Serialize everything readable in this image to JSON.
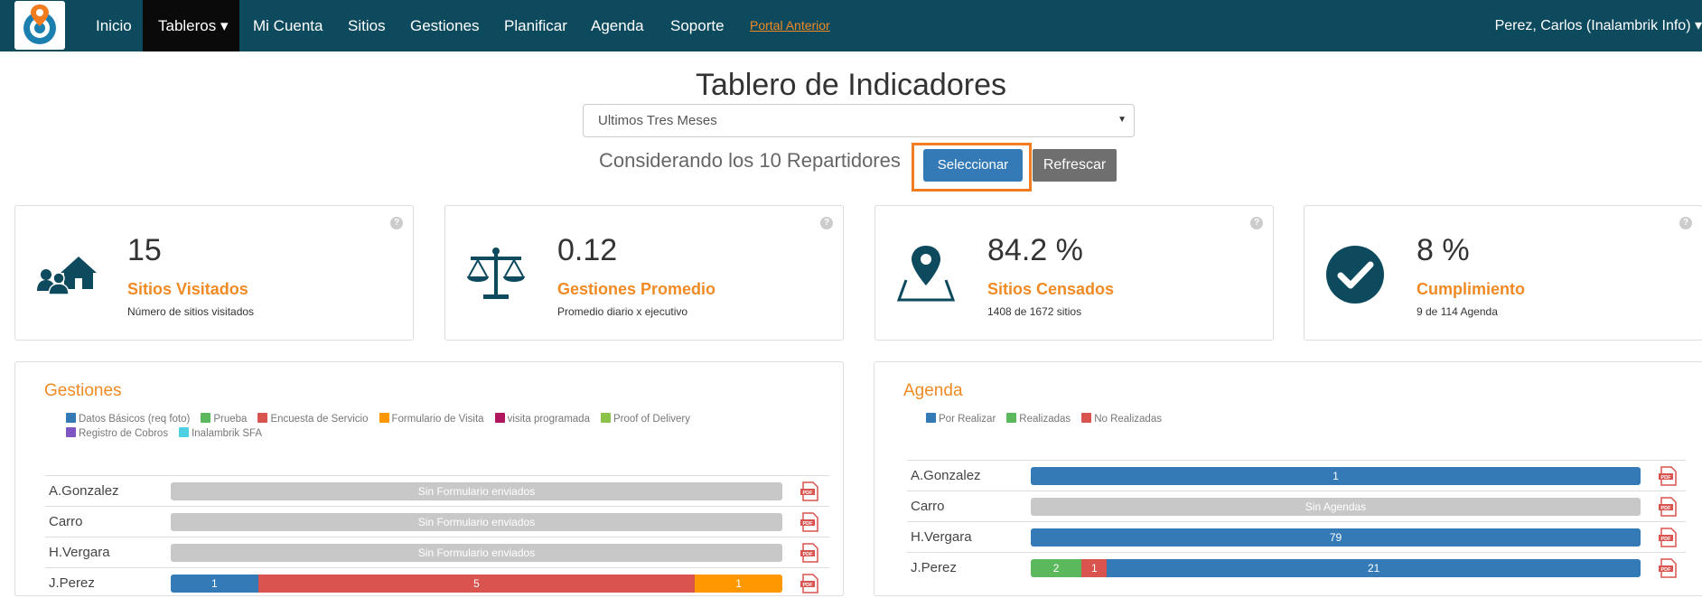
{
  "navbar": {
    "items": [
      {
        "label": "Inicio"
      },
      {
        "label": "Tableros ▾"
      },
      {
        "label": "Mi Cuenta"
      },
      {
        "label": "Sitios"
      },
      {
        "label": "Gestiones"
      },
      {
        "label": "Planificar"
      },
      {
        "label": "Agenda"
      },
      {
        "label": "Soporte"
      },
      {
        "label": "Portal Anterior"
      }
    ],
    "user": "Perez, Carlos (Inalambrik Info) ▾",
    "colors": {
      "bar": "#0d4a5e",
      "active": "#0a0a0a",
      "link": "#f08a24"
    }
  },
  "header": {
    "title": "Tablero de Indicadores",
    "period": "Ultimos Tres Meses",
    "considering": "Considerando los 10 Repartidores",
    "select_button": "Seleccionar",
    "refresh_button": "Refrescar"
  },
  "cards": [
    {
      "icon": "users-house-icon",
      "value": "15",
      "label": "Sitios Visitados",
      "desc": "Número de sitios visitados"
    },
    {
      "icon": "balance-scale-icon",
      "value": "0.12",
      "label": "Gestiones Promedio",
      "desc": "Promedio diario x ejecutivo"
    },
    {
      "icon": "map-marker-icon",
      "value": "84.2 %",
      "label": "Sitios Censados",
      "desc": "1408 de 1672 sitios"
    },
    {
      "icon": "check-circle-icon",
      "value": "8 %",
      "label": "Cumplimiento",
      "desc": "9 de 114 Agenda"
    }
  ],
  "gestiones": {
    "title": "Gestiones",
    "legend": [
      {
        "label": "Datos Básicos (req foto)",
        "color": "#337ab7"
      },
      {
        "label": "Prueba",
        "color": "#5cb85c"
      },
      {
        "label": "Encuesta de Servicio",
        "color": "#d9534f"
      },
      {
        "label": "Formulario de Visita",
        "color": "#ff9800"
      },
      {
        "label": "visita programada",
        "color": "#b0175e"
      },
      {
        "label": "Proof of Delivery",
        "color": "#8bc34a"
      },
      {
        "label": "Registro de Cobros",
        "color": "#7e57c2"
      },
      {
        "label": "Inalambrik SFA",
        "color": "#4dd0e1"
      }
    ],
    "rows": [
      {
        "name": "A.Gonzalez",
        "empty": "Sin Formulario enviados"
      },
      {
        "name": "Carro",
        "empty": "Sin Formulario enviados"
      },
      {
        "name": "H.Vergara",
        "empty": "Sin Formulario enviados"
      },
      {
        "name": "J.Perez",
        "segments": [
          {
            "value": 1,
            "label": "1",
            "color": "#337ab7"
          },
          {
            "value": 5,
            "label": "5",
            "color": "#d9534f"
          },
          {
            "value": 1,
            "label": "1",
            "color": "#ff9800"
          }
        ]
      }
    ]
  },
  "agenda": {
    "title": "Agenda",
    "legend": [
      {
        "label": "Por Realizar",
        "color": "#337ab7"
      },
      {
        "label": "Realizadas",
        "color": "#5cb85c"
      },
      {
        "label": "No Realizadas",
        "color": "#d9534f"
      }
    ],
    "rows": [
      {
        "name": "A.Gonzalez",
        "segments": [
          {
            "value": 1,
            "label": "1",
            "color": "#337ab7"
          }
        ]
      },
      {
        "name": "Carro",
        "empty": "Sin Agendas"
      },
      {
        "name": "H.Vergara",
        "segments": [
          {
            "value": 79,
            "label": "79",
            "color": "#337ab7"
          }
        ]
      },
      {
        "name": "J.Perez",
        "segments": [
          {
            "value": 2,
            "label": "2",
            "color": "#5cb85c"
          },
          {
            "value": 1,
            "label": "1",
            "color": "#d9534f"
          },
          {
            "value": 21,
            "label": "21",
            "color": "#337ab7"
          }
        ]
      }
    ]
  }
}
